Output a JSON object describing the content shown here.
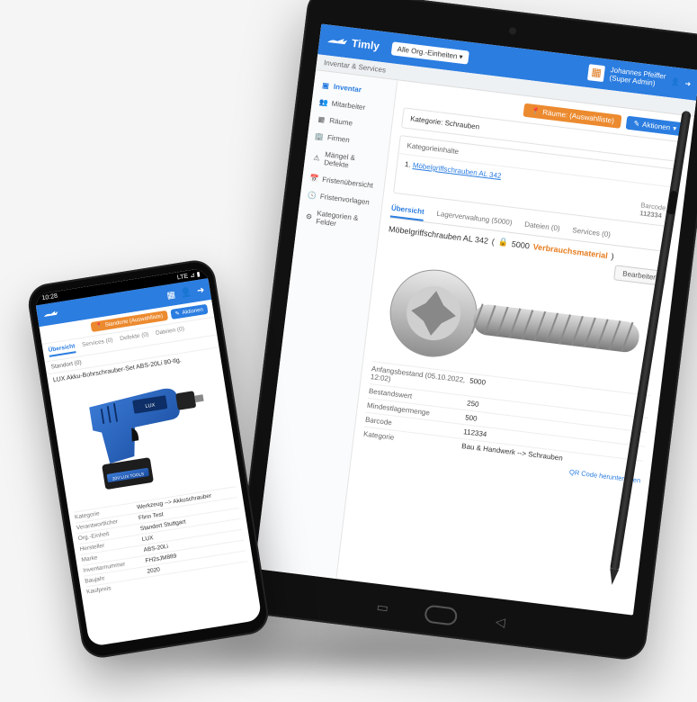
{
  "tablet": {
    "brand": "Timly",
    "org_select": "Alle Org.-Einheiten",
    "user_name": "Johannes Pfeiffer",
    "user_role": "(Super Admin)",
    "breadcrumb": "Inventar & Services",
    "sidebar": [
      {
        "icon": "▣",
        "label": "Inventar",
        "active": true
      },
      {
        "icon": "👥",
        "label": "Mitarbeiter"
      },
      {
        "icon": "▦",
        "label": "Räume"
      },
      {
        "icon": "🏢",
        "label": "Firmen"
      },
      {
        "icon": "⚠",
        "label": "Mängel & Defekte"
      },
      {
        "icon": "📅",
        "label": "Fristenübersicht"
      },
      {
        "icon": "🕓",
        "label": "Fristenvorlagen"
      },
      {
        "icon": "⚙",
        "label": "Kategorien & Felder"
      }
    ],
    "btn_rooms": "Räume: (Auswahlliste)",
    "btn_actions": "Aktionen",
    "cat_label": "Kategorie: Schrauben",
    "contents_label": "Kategorieinhalte",
    "item_index": "1.",
    "item_name": "Möbelgriffschrauben AL 342",
    "barcode_label": "Barcode",
    "barcode_value": "112334",
    "tabs": [
      "Übersicht",
      "Lagerverwaltung (5000)",
      "Dateien (0)",
      "Services (0)"
    ],
    "prod_name": "Möbelgriffschrauben AL 342",
    "prod_qty": "5000",
    "prod_type": "Verbrauchsmaterial",
    "btn_edit": "Bearbeiten",
    "specs": [
      {
        "lab": "Anfangsbestand (05.10.2022, 12:02)",
        "val": "5000"
      },
      {
        "lab": "Bestandswert",
        "val": "250"
      },
      {
        "lab": "Mindestlagermenge",
        "val": "500"
      },
      {
        "lab": "Barcode",
        "val": "112334"
      },
      {
        "lab": "Kategorie",
        "val": "Bau & Handwerk --> Schrauben"
      }
    ],
    "qr_link": "QR Code herunterladen"
  },
  "phone": {
    "time": "10:28",
    "net": "LTE ⊿ ▮",
    "btn_rooms": "Standorte (Auswahlliste)",
    "btn_actions": "Aktionen",
    "tabs": [
      "Übersicht",
      "Services (0)",
      "Defekte (0)",
      "Dateien (0)"
    ],
    "sub": "Standort (0)",
    "title": "LUX Akku-Bohrschrauber-Set ABS-20Li 80-tlg.",
    "specs": [
      {
        "lab": "Kategorie",
        "val": "Werkzeug --> Akkuschrauber"
      },
      {
        "lab": "Verantwortlicher",
        "val": "Flinn Test"
      },
      {
        "lab": "Org.-Einheit",
        "val": "Standort Stuttgart"
      },
      {
        "lab": "Hersteller",
        "val": "LUX"
      },
      {
        "lab": "Marke",
        "val": "ABS-20Li"
      },
      {
        "lab": "Inventarnummer",
        "val": "FH2sJM889"
      },
      {
        "lab": "Baujahr",
        "val": "2020"
      },
      {
        "lab": "Kaufpreis",
        "val": ""
      }
    ]
  }
}
